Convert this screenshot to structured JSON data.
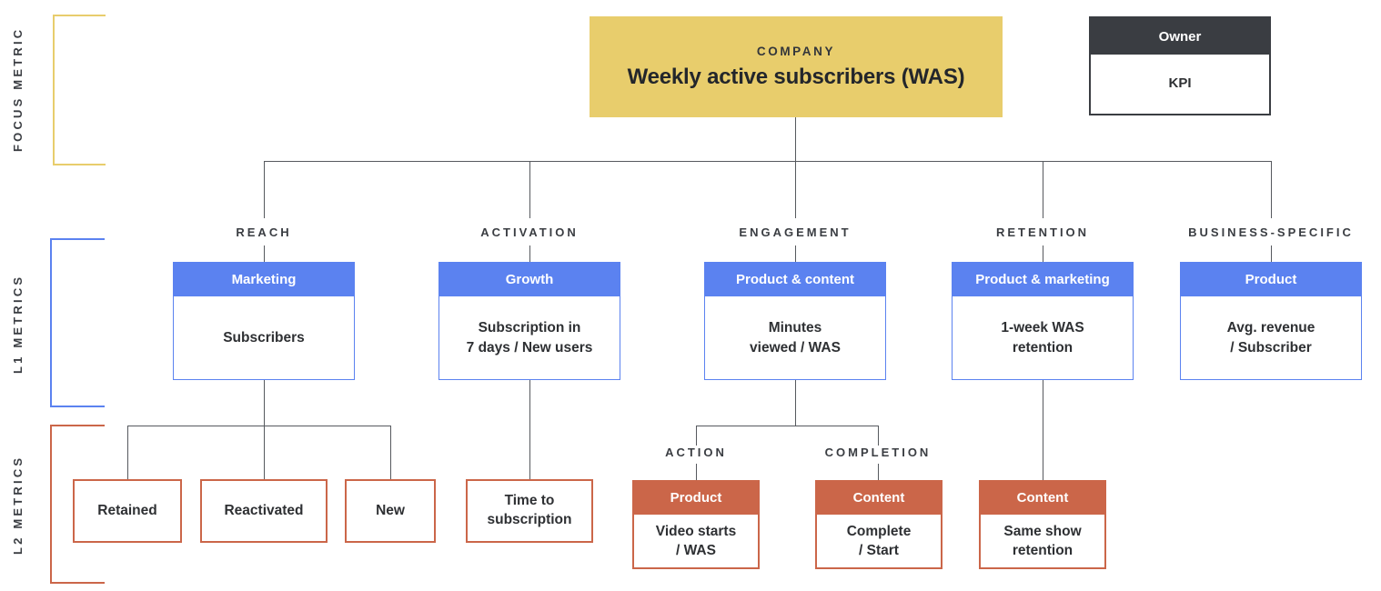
{
  "rows": {
    "focus_label": "FOCUS METRIC",
    "l1_label": "L1 METRICS",
    "l2_label": "L2 METRICS"
  },
  "focus_metric": {
    "owner": "COMPANY",
    "kpi": "Weekly active subscribers (WAS)"
  },
  "legend": {
    "owner_header": "Owner",
    "kpi_body": "KPI"
  },
  "colors": {
    "focus": "#e8cd6c",
    "l1": "#5b82f0",
    "l2": "#cb6649",
    "line": "#56595e",
    "legend_dark": "#3a3d42"
  },
  "categories": [
    {
      "name": "REACH"
    },
    {
      "name": "ACTIVATION"
    },
    {
      "name": "ENGAGEMENT"
    },
    {
      "name": "RETENTION"
    },
    {
      "name": "BUSINESS-SPECIFIC"
    }
  ],
  "l1_metrics": [
    {
      "owner": "Marketing",
      "kpi": "Subscribers"
    },
    {
      "owner": "Growth",
      "kpi": "Subscription in\n7 days / New users"
    },
    {
      "owner": "Product & content",
      "kpi": "Minutes\nviewed / WAS"
    },
    {
      "owner": "Product & marketing",
      "kpi": "1-week WAS\nretention"
    },
    {
      "owner": "Product",
      "kpi": "Avg. revenue\n/ Subscriber"
    }
  ],
  "sub_categories": [
    {
      "name": "ACTION"
    },
    {
      "name": "COMPLETION"
    }
  ],
  "l2_plain": [
    {
      "kpi": "Retained"
    },
    {
      "kpi": "Reactivated"
    },
    {
      "kpi": "New"
    },
    {
      "kpi": "Time to\nsubscription"
    }
  ],
  "l2_metrics": [
    {
      "owner": "Product",
      "kpi": "Video starts\n/ WAS"
    },
    {
      "owner": "Content",
      "kpi": "Complete\n/ Start"
    },
    {
      "owner": "Content",
      "kpi": "Same show\nretention"
    }
  ]
}
